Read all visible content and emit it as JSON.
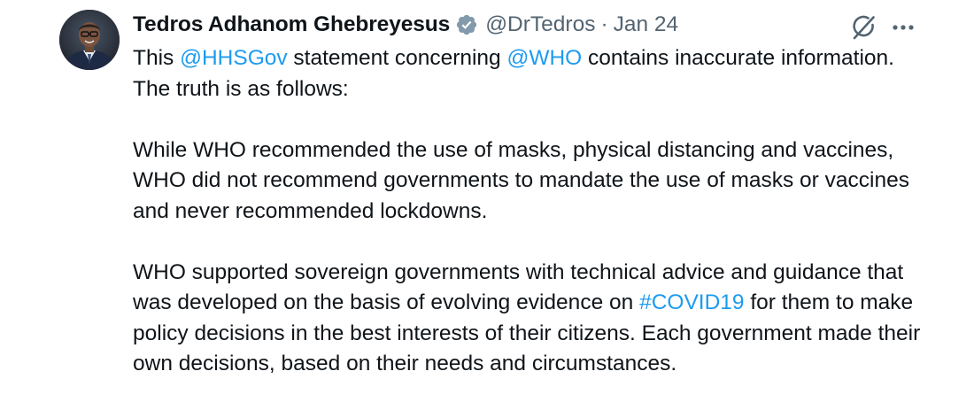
{
  "author": {
    "display_name": "Tedros Adhanom Ghebreyesus",
    "handle": "@DrTedros",
    "separator": "·",
    "date": "Jan 24",
    "verified": true,
    "verified_badge_color": "#829aab"
  },
  "icons": {
    "avatar": "avatar",
    "verified": "verified-badge-icon",
    "grok": "grok-icon",
    "more": "more-icon"
  },
  "colors": {
    "text": "#0f1419",
    "muted": "#536471",
    "link": "#1d9bf0"
  },
  "tweet": {
    "p1": {
      "t1": "This ",
      "mention1": "@HHSGov",
      "t2": " statement concerning ",
      "mention2": "@WHO",
      "t3": " contains inaccurate information. The truth is as follows:"
    },
    "p2": "While WHO recommended the use of masks, physical distancing and vaccines, WHO did not recommend governments to mandate the use of masks or vaccines and never recommended lockdowns.",
    "p3": {
      "t1": "WHO supported sovereign governments with technical advice and guidance that was developed on the basis of evolving evidence on ",
      "hashtag": "#COVID19",
      "t2": " for them to make policy decisions in the best interests of their citizens. Each government made their own decisions, based on their needs and circumstances."
    }
  }
}
